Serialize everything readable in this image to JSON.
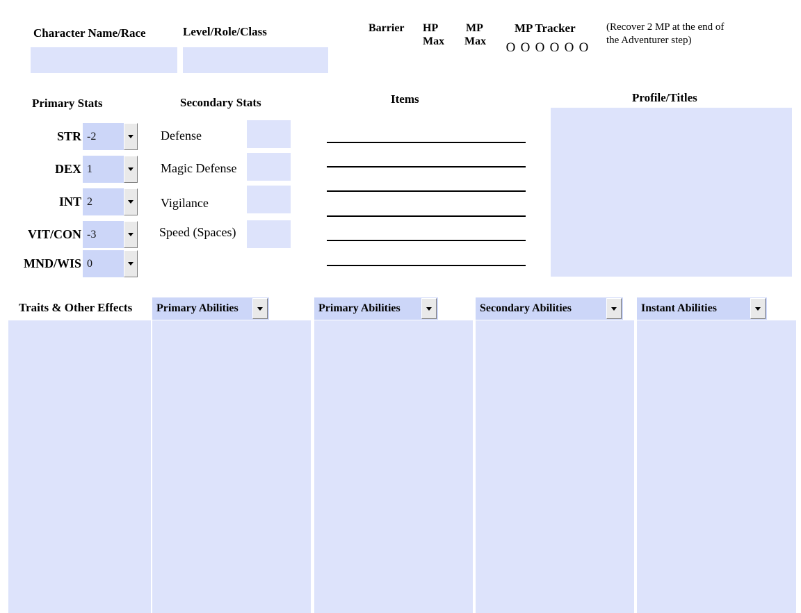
{
  "header": {
    "character_name_label": "Character Name/Race",
    "character_name_value": "",
    "character_name_placeholder": "",
    "level_role_label": "Level/Role/Class",
    "level_role_value": "",
    "level_role_placeholder": "",
    "barrier_label": "Barrier",
    "hp_max_label": "HP\nMax",
    "hp_max_line1": "HP",
    "hp_max_line2": "Max",
    "mp_max_line1": "MP",
    "mp_max_line2": "Max",
    "mp_tracker_label": "MP Tracker",
    "mp_tracker_marks": [
      "O",
      "O",
      "O",
      "O",
      "O",
      "O"
    ],
    "recover_note_line1": "(Recover 2 MP at the end of",
    "recover_note_line2": "the Adventurer step)"
  },
  "primary_stats": {
    "title": "Primary Stats",
    "rows": [
      {
        "label": "STR",
        "value": "-2"
      },
      {
        "label": "DEX",
        "value": "1"
      },
      {
        "label": "INT",
        "value": "2"
      },
      {
        "label": "VIT/CON",
        "value": "-3"
      },
      {
        "label": "MND/WIS",
        "value": "0"
      }
    ]
  },
  "secondary_stats": {
    "title": "Secondary Stats",
    "rows": [
      {
        "label": "Defense",
        "value": ""
      },
      {
        "label": "Magic Defense",
        "value": ""
      },
      {
        "label": "Vigilance",
        "value": ""
      },
      {
        "label": "Speed (Spaces)",
        "value": ""
      }
    ]
  },
  "items": {
    "title": "Items",
    "lines": [
      "",
      "",
      "",
      "",
      "",
      ""
    ]
  },
  "profile": {
    "title": "Profile/Titles",
    "value": ""
  },
  "bottom": {
    "traits_title": "Traits &  Other Effects",
    "traits_value": "",
    "columns": [
      {
        "title": "Primary Abilities",
        "value": ""
      },
      {
        "title": "Primary Abilities",
        "value": ""
      },
      {
        "title": "Secondary Abilities",
        "value": ""
      },
      {
        "title": "Instant Abilities",
        "value": ""
      }
    ]
  },
  "colors": {
    "field_fill": "#dde3fb",
    "dropdown_fill": "#ccd6f8",
    "button_face": "#e9e9e9",
    "text": "#000000",
    "page_background": "#ffffff"
  }
}
